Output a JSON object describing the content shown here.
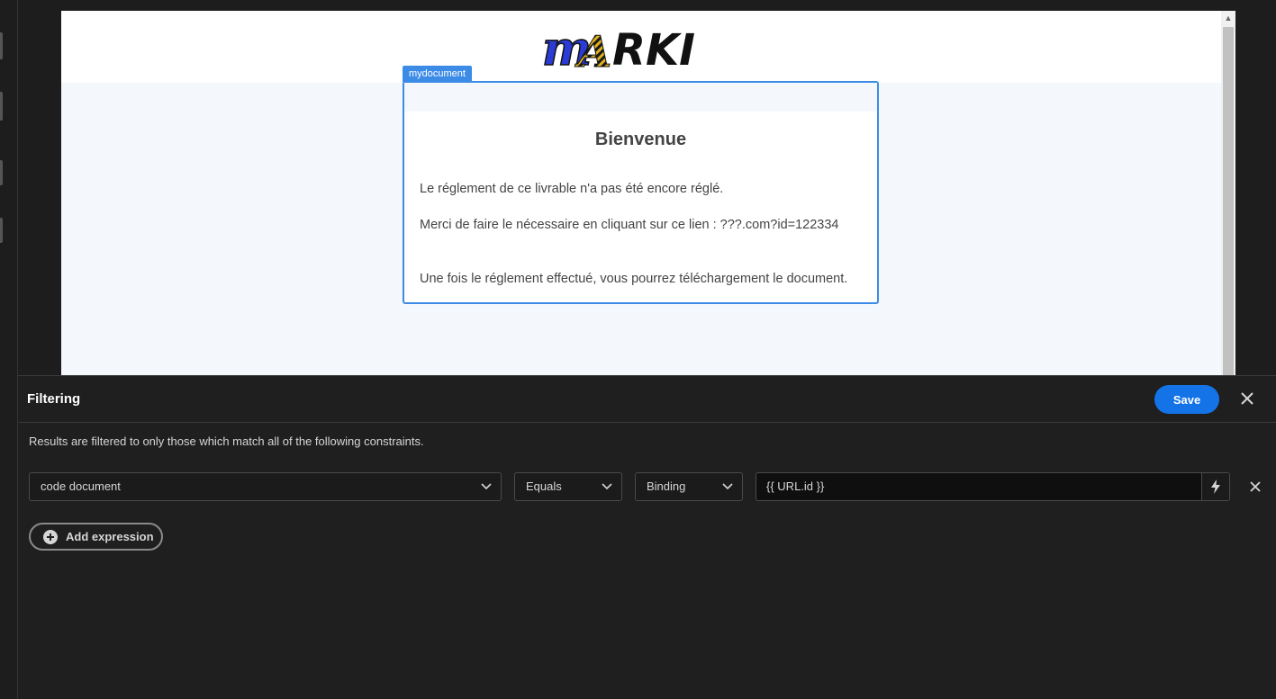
{
  "preview": {
    "logo_text": "MARKI",
    "component_tag": "mydocument",
    "card": {
      "title": "Bienvenue",
      "line1": "Le réglement de ce livrable n'a pas été encore réglé.",
      "line2": "Merci de faire le nécessaire en cliquant sur ce lien : ???.com?id=122334",
      "line3": "Une fois le réglement effectué, vous pourrez téléchargement le document."
    }
  },
  "panel": {
    "title": "Filtering",
    "save_label": "Save",
    "description": "Results are filtered to only those which match all of the following constraints.",
    "expression": {
      "field": "code document",
      "operator": "Equals",
      "type": "Binding",
      "value": "{{ URL.id }}"
    },
    "add_expression_label": "Add expression"
  },
  "colors": {
    "accent": "#1473e6",
    "selection": "#3c8ce7",
    "panel_bg": "#1f1f1f"
  }
}
